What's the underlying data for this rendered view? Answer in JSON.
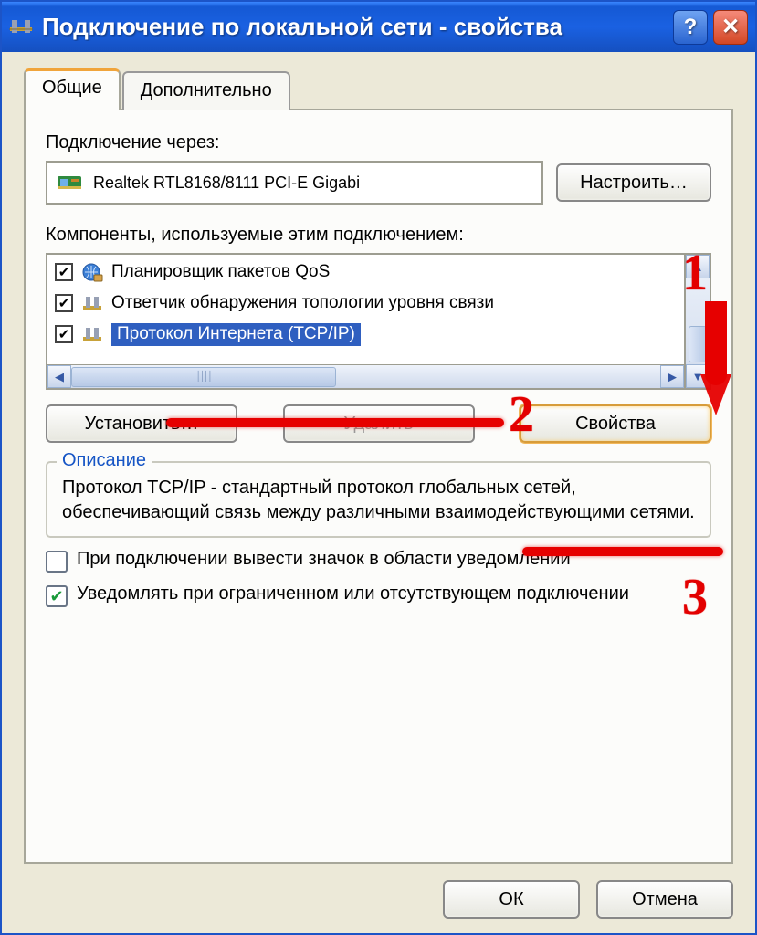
{
  "titlebar": {
    "title": "Подключение по локальной сети - свойства",
    "help": "?",
    "close": "✕"
  },
  "tabs": {
    "general": "Общие",
    "advanced": "Дополнительно"
  },
  "connect_via_label": "Подключение через:",
  "device_name": "Realtek RTL8168/8111 PCI-E Gigabi",
  "configure_button": "Настроить…",
  "components_label": "Компоненты, используемые этим подключением:",
  "items": [
    {
      "checked": true,
      "icon": "globe",
      "text": "Планировщик пакетов QoS",
      "selected": false
    },
    {
      "checked": true,
      "icon": "net",
      "text": "Ответчик обнаружения топологии уровня связи",
      "selected": false
    },
    {
      "checked": true,
      "icon": "net",
      "text": "Протокол Интернета (TCP/IP)",
      "selected": true
    }
  ],
  "install_button": "Установить…",
  "remove_button": "Удалить",
  "properties_button": "Свойства",
  "description_legend": "Описание",
  "description_text": "Протокол TCP/IP - стандартный протокол глобальных сетей, обеспечивающий связь между различными взаимодействующими сетями.",
  "notify_icon_label": "При подключении вывести значок в области уведомлений",
  "notify_limited_label": "Уведомлять при ограниченном или отсутствующем подключении",
  "ok_button": "ОК",
  "cancel_button": "Отмена",
  "annotations": {
    "one": "1",
    "two": "2",
    "three": "3"
  }
}
